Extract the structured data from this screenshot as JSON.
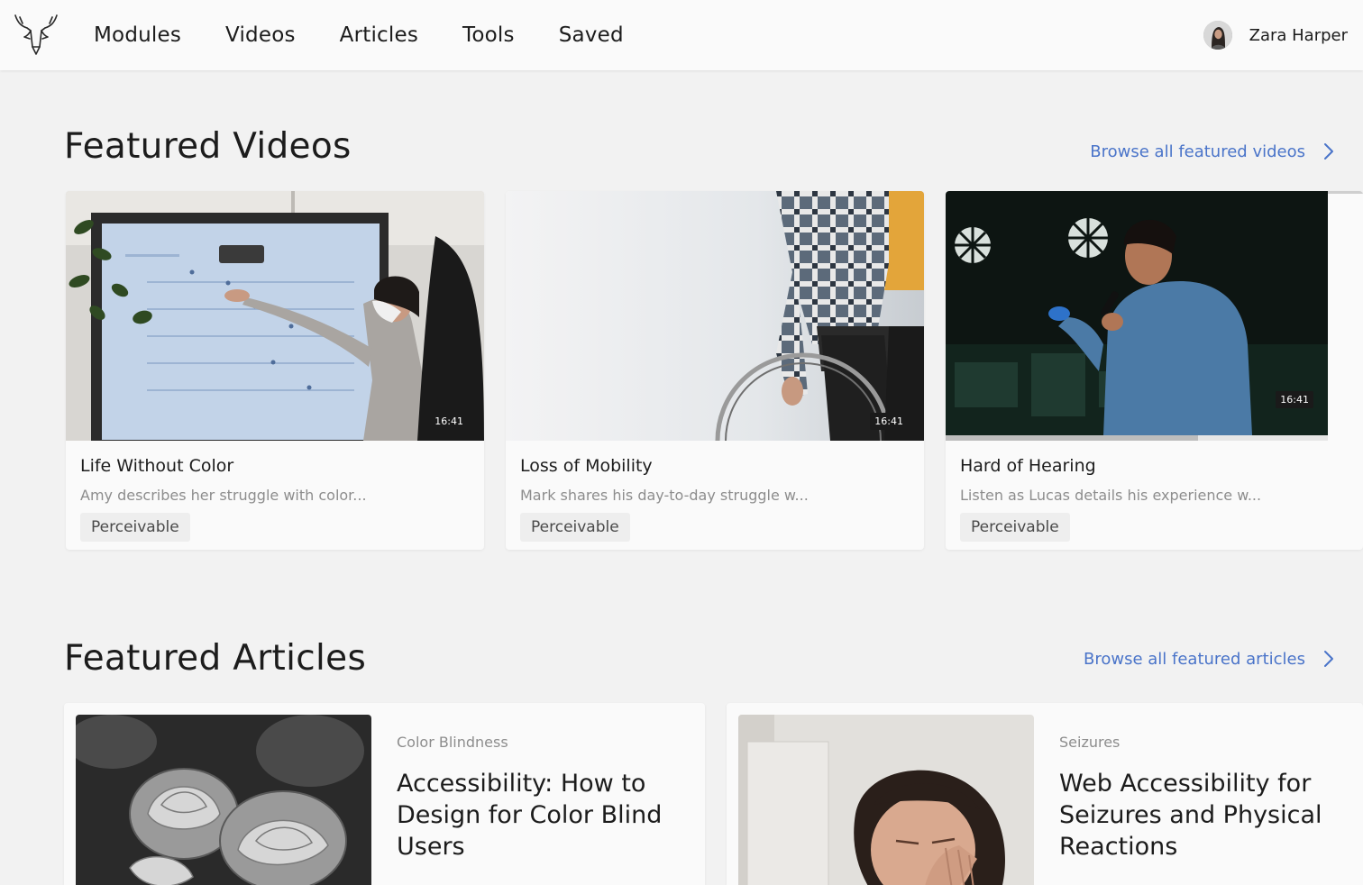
{
  "app": {
    "logo_icon": "deer-head-logo-icon"
  },
  "nav": {
    "items": [
      {
        "label": "Modules"
      },
      {
        "label": "Videos"
      },
      {
        "label": "Articles"
      },
      {
        "label": "Tools"
      },
      {
        "label": "Saved"
      }
    ]
  },
  "user": {
    "name": "Zara Harper",
    "avatar_icon": "user-avatar"
  },
  "featured_videos": {
    "title": "Featured Videos",
    "browse_label": "Browse all featured videos",
    "videos": [
      {
        "title": "Life Without Color",
        "description": "Amy describes her struggle with color...",
        "tag": "Perceivable",
        "duration": "16:41"
      },
      {
        "title": "Loss of Mobility",
        "description": "Mark shares his day-to-day struggle w...",
        "tag": "Perceivable",
        "duration": "16:41"
      },
      {
        "title": "Hard of Hearing",
        "description": "Listen as Lucas details his experience w...",
        "tag": "Perceivable",
        "duration": "16:41",
        "progress": 0.66
      }
    ]
  },
  "featured_articles": {
    "title": "Featured Articles",
    "browse_label": "Browse all featured articles",
    "articles": [
      {
        "category": "Color Blindness",
        "title": "Accessibility: How to Design for Color Blind Users"
      },
      {
        "category": "Seizures",
        "title": "Web Accessibility for Seizures and Physical Reactions"
      }
    ]
  },
  "colors": {
    "link": "#4a74c9",
    "background": "#f2f2f2",
    "card": "#fafafa"
  }
}
